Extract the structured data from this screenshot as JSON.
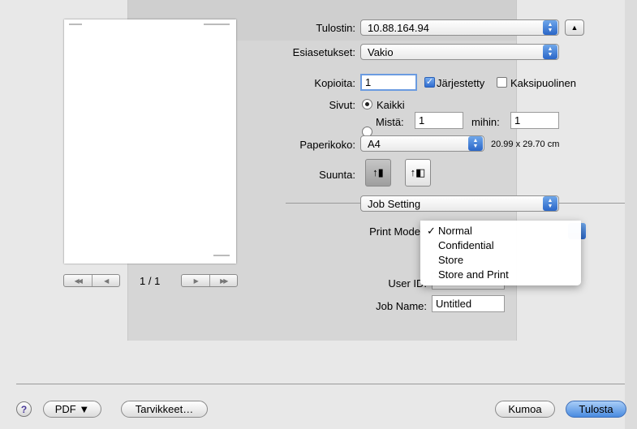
{
  "preview": {
    "page_counter": "1 / 1"
  },
  "form": {
    "printer": {
      "label": "Tulostin:",
      "value": "10.88.164.94"
    },
    "presets": {
      "label": "Esiasetukset:",
      "value": "Vakio"
    },
    "copies": {
      "label": "Kopioita:",
      "value": "1",
      "collated_label": "Järjestetty",
      "collated_checked": true,
      "duplex_label": "Kaksipuolinen",
      "duplex_checked": false
    },
    "pages": {
      "label": "Sivut:",
      "all_label": "Kaikki",
      "from_label": "Mistä:",
      "from_value": "1",
      "to_label": "mihin:",
      "to_value": "1"
    },
    "paper_size": {
      "label": "Paperikoko:",
      "value": "A4",
      "dimensions": "20.99 x 29.70 cm"
    },
    "orientation": {
      "label": "Suunta:",
      "selected": "portrait"
    },
    "section": {
      "value": "Job Setting"
    },
    "print_mode": {
      "label": "Print Mode",
      "options": [
        "Normal",
        "Confidential",
        "Store",
        "Store and Print"
      ],
      "selected": "Normal"
    },
    "user_id": {
      "label": "User ID:"
    },
    "job_name": {
      "label": "Job Name:",
      "value": "Untitled"
    }
  },
  "footer": {
    "help": "?",
    "pdf": "PDF ▼",
    "supplies": "Tarvikkeet…",
    "cancel": "Kumoa",
    "print": "Tulosta"
  },
  "colors": {
    "accent": "#2a66c8",
    "default_button": "#4a8be0"
  }
}
